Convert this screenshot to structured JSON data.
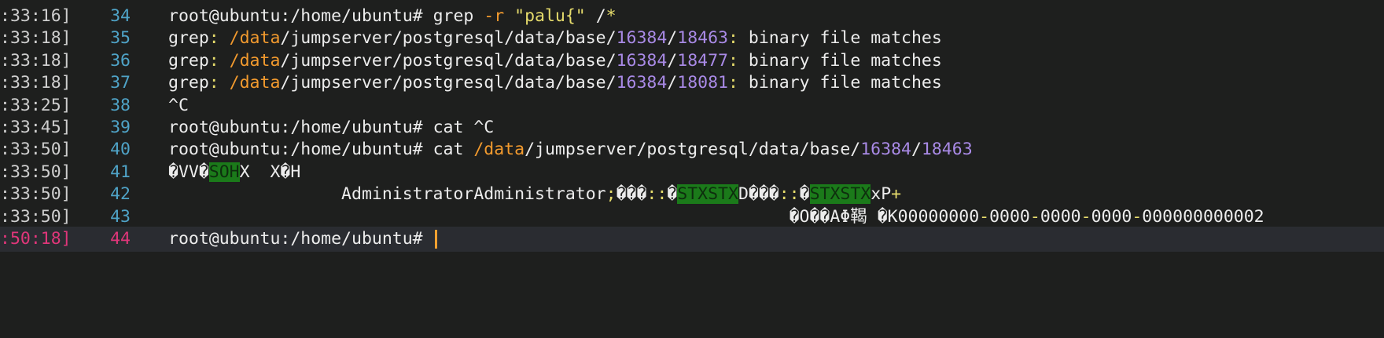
{
  "terminal": {
    "lines": [
      {
        "ts": ":33:16]",
        "num": "34",
        "segs": [
          {
            "t": "root@ubuntu",
            "c": "c-white"
          },
          {
            "t": ":/home/ubuntu# ",
            "c": "c-white"
          },
          {
            "t": "grep ",
            "c": "c-white"
          },
          {
            "t": "-r ",
            "c": "c-orange"
          },
          {
            "t": "\"palu{\"",
            "c": "c-yellow"
          },
          {
            "t": " /",
            "c": "c-white"
          },
          {
            "t": "*",
            "c": "c-yellow"
          }
        ]
      },
      {
        "ts": ":33:18]",
        "num": "35",
        "segs": [
          {
            "t": "grep",
            "c": "c-white"
          },
          {
            "t": ": ",
            "c": "c-yellow"
          },
          {
            "t": "/data",
            "c": "c-orange"
          },
          {
            "t": "/jumpserver/postgresql/data/base/",
            "c": "c-white"
          },
          {
            "t": "16384",
            "c": "c-purple"
          },
          {
            "t": "/",
            "c": "c-white"
          },
          {
            "t": "18463",
            "c": "c-purple"
          },
          {
            "t": ": ",
            "c": "c-yellow"
          },
          {
            "t": "binary file matches",
            "c": "c-white"
          }
        ]
      },
      {
        "ts": ":33:18]",
        "num": "36",
        "segs": [
          {
            "t": "grep",
            "c": "c-white"
          },
          {
            "t": ": ",
            "c": "c-yellow"
          },
          {
            "t": "/data",
            "c": "c-orange"
          },
          {
            "t": "/jumpserver/postgresql/data/base/",
            "c": "c-white"
          },
          {
            "t": "16384",
            "c": "c-purple"
          },
          {
            "t": "/",
            "c": "c-white"
          },
          {
            "t": "18477",
            "c": "c-purple"
          },
          {
            "t": ": ",
            "c": "c-yellow"
          },
          {
            "t": "binary file matches",
            "c": "c-white"
          }
        ]
      },
      {
        "ts": ":33:18]",
        "num": "37",
        "segs": [
          {
            "t": "grep",
            "c": "c-white"
          },
          {
            "t": ": ",
            "c": "c-yellow"
          },
          {
            "t": "/data",
            "c": "c-orange"
          },
          {
            "t": "/jumpserver/postgresql/data/base/",
            "c": "c-white"
          },
          {
            "t": "16384",
            "c": "c-purple"
          },
          {
            "t": "/",
            "c": "c-white"
          },
          {
            "t": "18081",
            "c": "c-purple"
          },
          {
            "t": ": ",
            "c": "c-yellow"
          },
          {
            "t": "binary file matches",
            "c": "c-white"
          }
        ]
      },
      {
        "ts": ":33:25]",
        "num": "38",
        "segs": [
          {
            "t": "^C",
            "c": "c-white"
          }
        ]
      },
      {
        "ts": ":33:45]",
        "num": "39",
        "segs": [
          {
            "t": "root@ubuntu",
            "c": "c-white"
          },
          {
            "t": ":/home/ubuntu# ",
            "c": "c-white"
          },
          {
            "t": "cat ^C",
            "c": "c-white"
          }
        ]
      },
      {
        "ts": ":33:50]",
        "num": "40",
        "segs": [
          {
            "t": "root@ubuntu",
            "c": "c-white"
          },
          {
            "t": ":/home/ubuntu# ",
            "c": "c-white"
          },
          {
            "t": "cat ",
            "c": "c-white"
          },
          {
            "t": "/data",
            "c": "c-orange"
          },
          {
            "t": "/jumpserver/postgresql/data/base/",
            "c": "c-white"
          },
          {
            "t": "16384",
            "c": "c-purple"
          },
          {
            "t": "/",
            "c": "c-white"
          },
          {
            "t": "18463",
            "c": "c-purple"
          }
        ]
      },
      {
        "ts": ":33:50]",
        "num": "41",
        "segs": [
          {
            "t": "�VV�",
            "c": "c-white"
          },
          {
            "t": "SOH",
            "c": "ctl"
          },
          {
            "t": "X  X�H",
            "c": "c-white"
          }
        ]
      },
      {
        "ts": ":33:50]",
        "num": "42",
        "segs": [
          {
            "t": "                 AdministratorAdministrator",
            "c": "c-white"
          },
          {
            "t": ";",
            "c": "c-yellow"
          },
          {
            "t": "���",
            "c": "c-white"
          },
          {
            "t": "::",
            "c": "c-yellow"
          },
          {
            "t": "�",
            "c": "c-white"
          },
          {
            "t": "STX",
            "c": "ctl"
          },
          {
            "t": "STX",
            "c": "ctl"
          },
          {
            "t": "D���",
            "c": "c-white"
          },
          {
            "t": "::",
            "c": "c-yellow"
          },
          {
            "t": "�",
            "c": "c-white"
          },
          {
            "t": "STX",
            "c": "ctl"
          },
          {
            "t": "STX",
            "c": "ctl"
          },
          {
            "t": "xP",
            "c": "c-white"
          },
          {
            "t": "+",
            "c": "c-yellow"
          }
        ]
      },
      {
        "ts": ":33:50]",
        "num": "43",
        "segs": [
          {
            "t": "                                                             �O��AΦ鞨 �K00000000",
            "c": "c-white"
          },
          {
            "t": "-",
            "c": "c-yellow"
          },
          {
            "t": "0000",
            "c": "c-white"
          },
          {
            "t": "-",
            "c": "c-yellow"
          },
          {
            "t": "0000",
            "c": "c-white"
          },
          {
            "t": "-",
            "c": "c-yellow"
          },
          {
            "t": "0000",
            "c": "c-white"
          },
          {
            "t": "-",
            "c": "c-yellow"
          },
          {
            "t": "000000000002",
            "c": "c-white"
          }
        ]
      },
      {
        "ts": ":50:18]",
        "num": "44",
        "active": true,
        "segs": [
          {
            "t": "root@ubuntu",
            "c": "c-white"
          },
          {
            "t": ":/home/ubuntu# ",
            "c": "c-white"
          }
        ]
      }
    ]
  },
  "colors": {
    "background": "#1e1f1e",
    "active_line": "#2a2c31",
    "line_number": "#4fa3c7",
    "active_accent": "#e0367a",
    "path_orange": "#f29a2e",
    "number_purple": "#a98ae6",
    "control_char_bg": "#1b7a1a",
    "cursor": "#f0a030"
  }
}
